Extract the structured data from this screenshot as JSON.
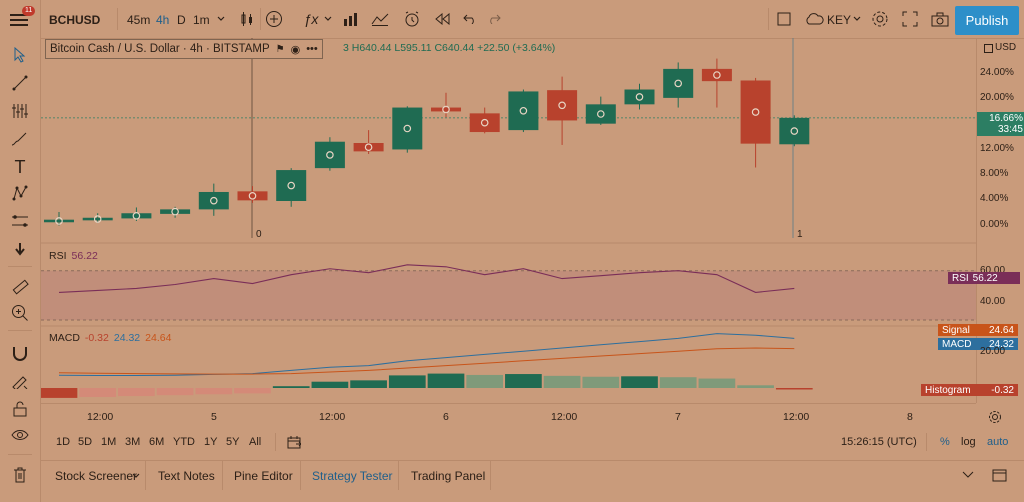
{
  "header": {
    "notification_count": "11",
    "symbol": "BCHUSD",
    "intervals": [
      "45m",
      "4h",
      "D",
      "1m"
    ],
    "key_label": "KEY",
    "publish_label": "Publish"
  },
  "legend": {
    "title": "Bitcoin Cash / U.S. Dollar · 4h · BITSTAMP",
    "ohlc": "3  H640.44  L595.11  C640.44  +22.50 (+3.64%)"
  },
  "price_axis": {
    "currency": "USD",
    "labels": [
      "24.00%",
      "20.00%",
      "16.00%",
      "12.00%",
      "8.00%",
      "4.00%",
      "0.00%"
    ],
    "current_value": "16.66%",
    "countdown": "33:45"
  },
  "markers": {
    "left": "0",
    "right": "1"
  },
  "rsi": {
    "label": "RSI",
    "value": "56.22",
    "axis_labels": [
      "60.00",
      "40.00"
    ],
    "tag": "RSI",
    "tag_value": "56.22"
  },
  "macd": {
    "label": "MACD",
    "values": [
      "-0.32",
      "24.32",
      "24.64"
    ],
    "axis_label": "20.00",
    "signal_tag": "Signal",
    "signal_value": "24.64",
    "macd_tag": "MACD",
    "macd_value": "24.32",
    "hist_tag": "Histogram",
    "hist_value": "-0.32"
  },
  "time_axis": [
    "12:00",
    "5",
    "12:00",
    "6",
    "12:00",
    "7",
    "12:00",
    "8"
  ],
  "bottom_bar": {
    "ranges": [
      "1D",
      "5D",
      "1M",
      "3M",
      "6M",
      "YTD",
      "1Y",
      "5Y",
      "All"
    ],
    "clock": "15:26:15 (UTC)",
    "percent": "%",
    "log": "log",
    "auto": "auto"
  },
  "tabs": [
    "Stock Screener",
    "Text Notes",
    "Pine Editor",
    "Strategy Tester",
    "Trading Panel"
  ],
  "colors": {
    "up": "#1f6b52",
    "down": "#b8422d",
    "rsi": "#7a2e58",
    "macd": "#2d6f9e",
    "signal": "#c8541a",
    "accent": "#2d8fc9"
  },
  "chart_data": {
    "type": "candlestick",
    "price_scale": "percent",
    "ylim": [
      -1,
      26
    ],
    "candles": [
      {
        "o": 0.2,
        "h": 1.8,
        "l": -0.3,
        "c": 0.6
      },
      {
        "o": 0.5,
        "h": 1.6,
        "l": 0.1,
        "c": 0.9
      },
      {
        "o": 0.8,
        "h": 2.5,
        "l": 0.4,
        "c": 1.6
      },
      {
        "o": 1.5,
        "h": 2.6,
        "l": 0.9,
        "c": 2.2
      },
      {
        "o": 2.2,
        "h": 6.2,
        "l": 1.2,
        "c": 4.9
      },
      {
        "o": 5.0,
        "h": 5.8,
        "l": 3.2,
        "c": 3.6
      },
      {
        "o": 3.5,
        "h": 8.6,
        "l": 2.6,
        "c": 8.3
      },
      {
        "o": 8.6,
        "h": 13.4,
        "l": 8.2,
        "c": 12.7
      },
      {
        "o": 12.5,
        "h": 14.5,
        "l": 10.8,
        "c": 11.2
      },
      {
        "o": 11.5,
        "h": 18.2,
        "l": 11.0,
        "c": 18.0
      },
      {
        "o": 18.0,
        "h": 20.3,
        "l": 16.5,
        "c": 17.4
      },
      {
        "o": 17.1,
        "h": 18.0,
        "l": 14.0,
        "c": 14.2
      },
      {
        "o": 14.5,
        "h": 20.8,
        "l": 14.2,
        "c": 20.5
      },
      {
        "o": 20.7,
        "h": 22.8,
        "l": 12.2,
        "c": 16.0
      },
      {
        "o": 15.5,
        "h": 19.7,
        "l": 15.3,
        "c": 18.5
      },
      {
        "o": 18.5,
        "h": 21.7,
        "l": 17.7,
        "c": 20.8
      },
      {
        "o": 19.5,
        "h": 25.0,
        "l": 18.0,
        "c": 24.0
      },
      {
        "o": 24.0,
        "h": 25.6,
        "l": 18.0,
        "c": 22.1
      },
      {
        "o": 22.2,
        "h": 22.6,
        "l": 8.7,
        "c": 12.4
      },
      {
        "o": 12.3,
        "h": 16.8,
        "l": 12.0,
        "c": 16.4
      }
    ],
    "rsi": [
      58,
      60,
      62,
      66,
      72,
      67,
      76,
      82,
      78,
      86,
      84,
      76,
      82,
      72,
      75,
      78,
      80,
      76,
      58,
      62
    ],
    "macd_line": [
      8,
      7.8,
      7.8,
      8,
      8.5,
      9,
      11,
      13,
      14,
      17,
      19,
      21,
      23,
      25,
      27,
      29,
      31,
      34,
      33,
      31
    ],
    "signal_line": [
      9.5,
      9.2,
      9,
      8.8,
      8.7,
      8.7,
      9,
      10,
      11,
      12.5,
      14,
      15.5,
      17,
      18.5,
      20,
      21.5,
      23,
      24.5,
      25,
      24.6
    ],
    "histogram": [
      -2.2,
      -2,
      -1.8,
      -1.6,
      -1.4,
      -1.2,
      0.4,
      1.4,
      1.7,
      2.8,
      3.2,
      2.9,
      3.1,
      2.7,
      2.5,
      2.6,
      2.4,
      2.1,
      0.6,
      -0.3
    ]
  }
}
